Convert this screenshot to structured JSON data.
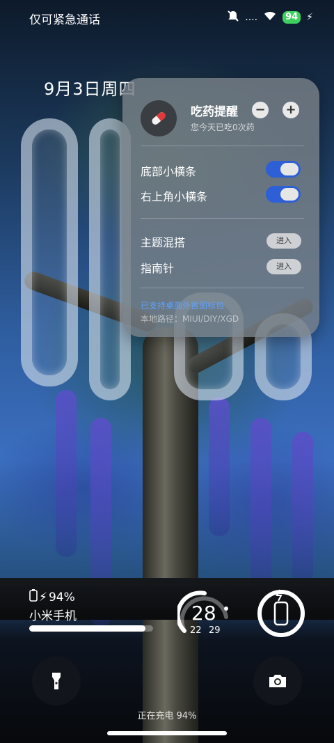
{
  "status_bar": {
    "carrier": "仅可紧急通话",
    "signal_dots": "....",
    "battery": "94"
  },
  "date": "9月3日周四",
  "medicine_card": {
    "title": "吃药提醒",
    "subtitle": "您今天已吃0次药",
    "minus": "−",
    "plus": "+",
    "toggles": [
      {
        "label": "底部小横条",
        "on": true
      },
      {
        "label": "右上角小横条",
        "on": true
      }
    ],
    "entries": [
      {
        "label": "主题混搭",
        "button": "进入"
      },
      {
        "label": "指南针",
        "button": "进入"
      }
    ],
    "link": "已支持桌面外置图标包",
    "path": "本地路径：MIUI/DIY/XGD"
  },
  "battery_widget": {
    "percent_text": "94%",
    "device_name": "小米手机",
    "level": 0.94
  },
  "temperature": {
    "current": "28",
    "low": "22",
    "high": "29"
  },
  "charging_text": "正在充电 94%",
  "colors": {
    "accent": "#2d5fd6",
    "battery_green": "#3ecf5f",
    "link": "#5ea3ff"
  },
  "icons": [
    "mute-icon",
    "wifi-icon",
    "pill-icon",
    "flashlight-icon",
    "camera-icon",
    "phone-icon",
    "bolt-icon"
  ]
}
